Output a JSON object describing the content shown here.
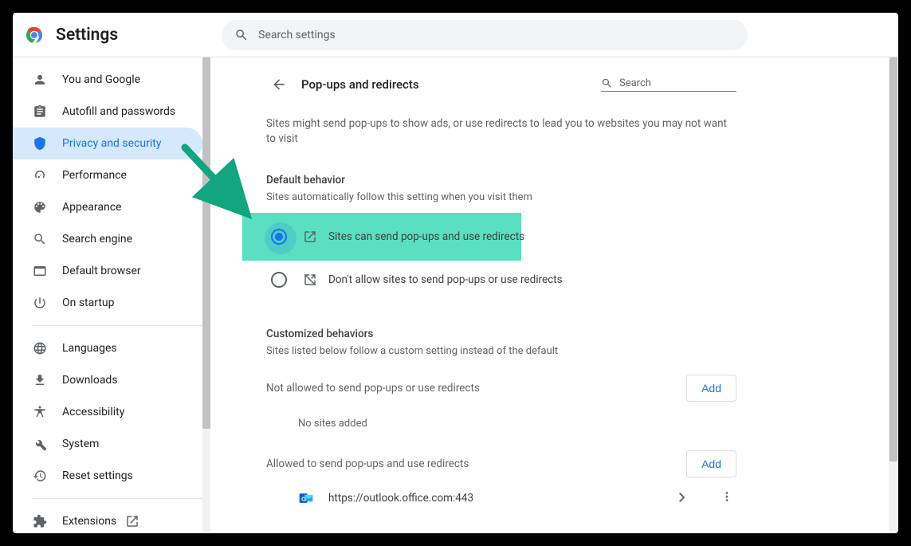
{
  "app_title": "Settings",
  "search_placeholder": "Search settings",
  "nav": [
    {
      "id": "you",
      "label": "You and Google"
    },
    {
      "id": "autofill",
      "label": "Autofill and passwords"
    },
    {
      "id": "privacy",
      "label": "Privacy and security",
      "active": true
    },
    {
      "id": "performance",
      "label": "Performance"
    },
    {
      "id": "appearance",
      "label": "Appearance"
    },
    {
      "id": "search",
      "label": "Search engine"
    },
    {
      "id": "default",
      "label": "Default browser"
    },
    {
      "id": "startup",
      "label": "On startup"
    }
  ],
  "nav2": [
    {
      "id": "languages",
      "label": "Languages"
    },
    {
      "id": "downloads",
      "label": "Downloads"
    },
    {
      "id": "accessibility",
      "label": "Accessibility"
    },
    {
      "id": "system",
      "label": "System"
    },
    {
      "id": "reset",
      "label": "Reset settings"
    }
  ],
  "nav3": [
    {
      "id": "extensions",
      "label": "Extensions"
    }
  ],
  "page": {
    "title": "Pop-ups and redirects",
    "search_placeholder": "Search",
    "description": "Sites might send pop-ups to show ads, or use redirects to lead you to websites you may not want to visit",
    "default_behavior": {
      "heading": "Default behavior",
      "subheading": "Sites automatically follow this setting when you visit them",
      "options": [
        {
          "id": "allow",
          "label": "Sites can send pop-ups and use redirects",
          "selected": true
        },
        {
          "id": "block",
          "label": "Don't allow sites to send pop-ups or use redirects",
          "selected": false
        }
      ]
    },
    "customized": {
      "heading": "Customized behaviors",
      "subheading": "Sites listed below follow a custom setting instead of the default",
      "not_allowed": {
        "label": "Not allowed to send pop-ups or use redirects",
        "add_label": "Add",
        "empty_label": "No sites added"
      },
      "allowed": {
        "label": "Allowed to send pop-ups and use redirects",
        "add_label": "Add",
        "sites": [
          {
            "url": "https://outlook.office.com:443"
          }
        ]
      }
    }
  }
}
